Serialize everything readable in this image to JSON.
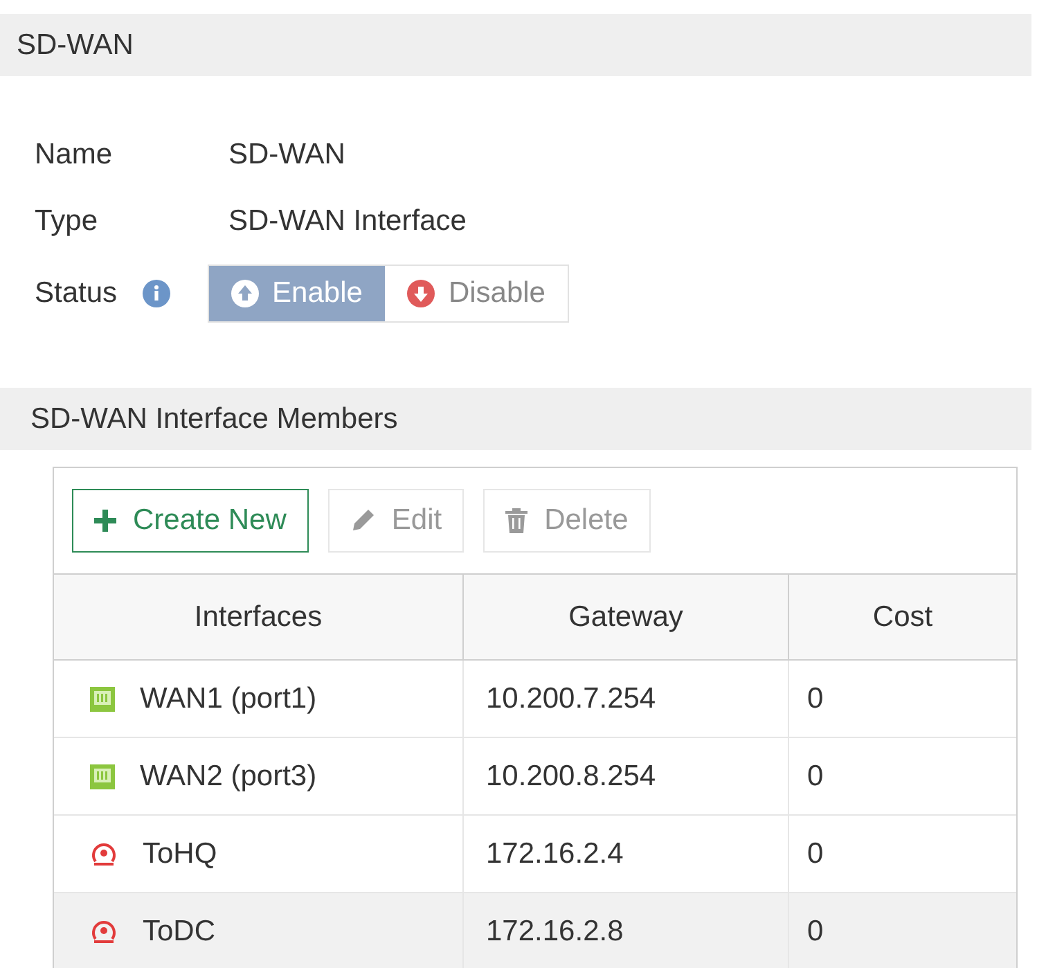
{
  "section_title": "SD-WAN",
  "fields": [
    {
      "label": "Name",
      "value": "SD-WAN"
    },
    {
      "label": "Type",
      "value": "SD-WAN Interface"
    }
  ],
  "status": {
    "label": "Status",
    "options": [
      {
        "label": "Enable",
        "kind": "up",
        "selected": true
      },
      {
        "label": "Disable",
        "kind": "down",
        "selected": false
      }
    ]
  },
  "members": {
    "title": "SD-WAN Interface Members",
    "toolbar": [
      {
        "label": "Create New",
        "kind": "create",
        "disabled": false
      },
      {
        "label": "Edit",
        "kind": "edit",
        "disabled": true
      },
      {
        "label": "Delete",
        "kind": "delete",
        "disabled": true
      }
    ],
    "columns": [
      "Interfaces",
      "Gateway",
      "Cost"
    ],
    "rows": [
      {
        "interface": "WAN1 (port1)",
        "kind": "physical",
        "gateway": "10.200.7.254",
        "cost": "0",
        "selected": false
      },
      {
        "interface": "WAN2 (port3)",
        "kind": "physical",
        "gateway": "10.200.8.254",
        "cost": "0",
        "selected": false
      },
      {
        "interface": "ToHQ",
        "kind": "tunnel",
        "gateway": "172.16.2.4",
        "cost": "0",
        "selected": false
      },
      {
        "interface": "ToDC",
        "kind": "tunnel",
        "gateway": "172.16.2.8",
        "cost": "0",
        "selected": true
      }
    ]
  }
}
